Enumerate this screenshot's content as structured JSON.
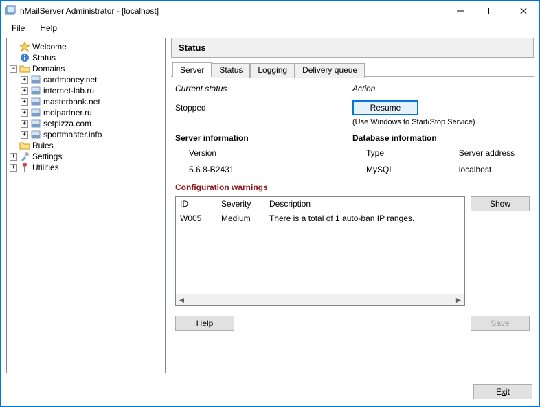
{
  "titlebar": {
    "text": "hMailServer Administrator - [localhost]"
  },
  "menubar": {
    "file": "File",
    "help": "Help"
  },
  "tree": {
    "welcome": "Welcome",
    "status": "Status",
    "domains": "Domains",
    "domain_items": [
      "cardmoney.net",
      "internet-lab.ru",
      "masterbank.net",
      "moipartner.ru",
      "setpizza.com",
      "sportmaster.info"
    ],
    "rules": "Rules",
    "settings": "Settings",
    "utilities": "Utilities"
  },
  "header": {
    "title": "Status"
  },
  "tabs": {
    "server": "Server",
    "status": "Status",
    "logging": "Logging",
    "delivery": "Delivery queue"
  },
  "status_section": {
    "current_status_label": "Current status",
    "action_label": "Action",
    "status_value": "Stopped",
    "resume_button": "Resume",
    "hint": "(Use Windows to Start/Stop Service)"
  },
  "server_info": {
    "title": "Server information",
    "version_label": "Version",
    "version_value": "5.6.8-B2431"
  },
  "db_info": {
    "title": "Database information",
    "type_label": "Type",
    "type_value": "MySQL",
    "addr_label": "Server address",
    "addr_value": "localhost"
  },
  "config_warnings": {
    "title": "Configuration warnings",
    "cols": {
      "id": "ID",
      "severity": "Severity",
      "desc": "Description"
    },
    "rows": [
      {
        "id": "W005",
        "severity": "Medium",
        "desc": "There is a total of 1 auto-ban IP ranges."
      }
    ],
    "show_button": "Show"
  },
  "buttons": {
    "help": "Help",
    "save": "Save",
    "exit": "Exit"
  }
}
